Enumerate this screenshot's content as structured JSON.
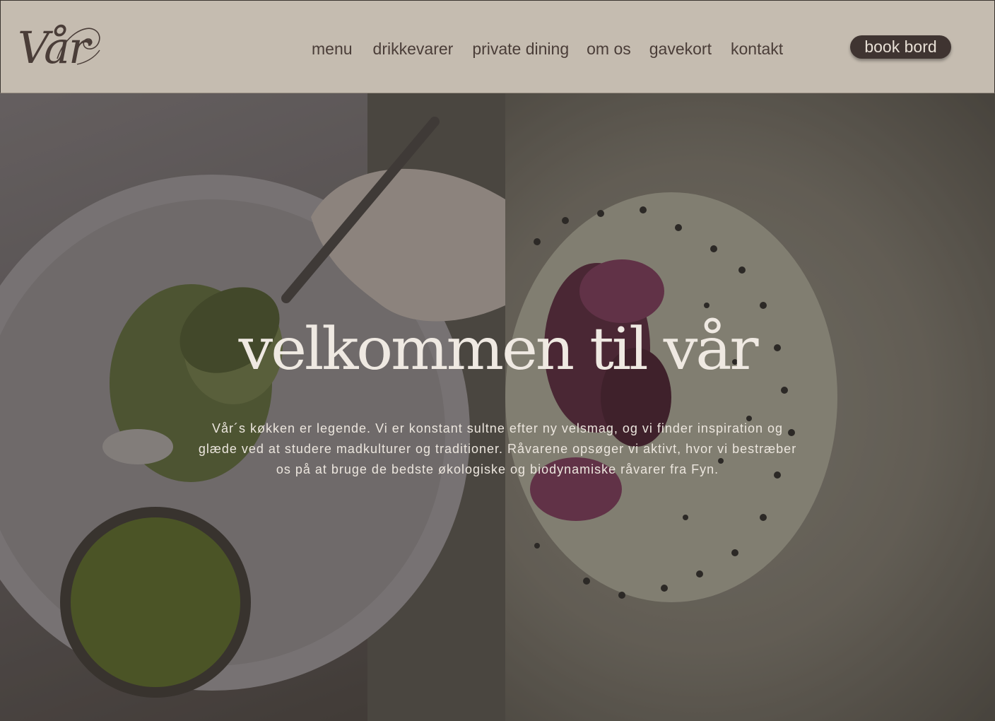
{
  "header": {
    "logo_text": "Vår",
    "nav": [
      {
        "label": "menu"
      },
      {
        "label": "drikkevarer"
      },
      {
        "label": "private dining"
      },
      {
        "label": "om os"
      },
      {
        "label": "gavekort"
      },
      {
        "label": "kontakt"
      }
    ],
    "book_label": "book bord"
  },
  "hero": {
    "title": "velkommen til vår",
    "text": "Vår´s køkken er legende. Vi er konstant sultne efter ny velsmag, og vi finder inspiration og glæde ved at studere madkulturer og traditioner. Råvarene opsøger vi aktivt, hvor vi bestræber os på at bruge de bedste økologiske og biodynamiske råvarer fra Fyn."
  },
  "colors": {
    "header_bg": "#c5bcb0",
    "nav_text": "#4a3d38",
    "button_bg": "#3f3431",
    "button_text": "#e8e0d6",
    "hero_text": "#efe9e2"
  }
}
